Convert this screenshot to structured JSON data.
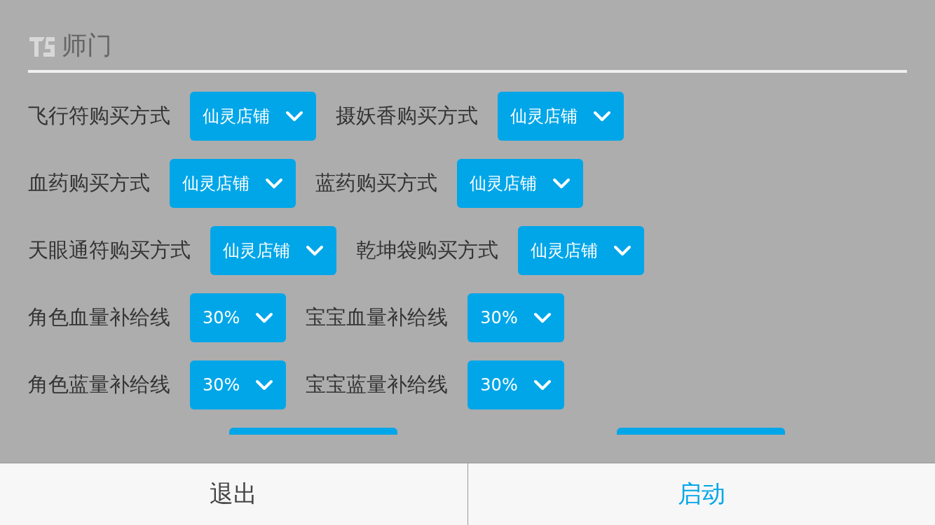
{
  "header": {
    "title": "师门"
  },
  "rows": [
    {
      "kind": "full",
      "items": [
        {
          "label": "飞行符购买方式",
          "value": "仙灵店铺"
        },
        {
          "label": "摄妖香购买方式",
          "value": "仙灵店铺"
        }
      ]
    },
    {
      "kind": "full",
      "items": [
        {
          "label": "血药购买方式",
          "value": "仙灵店铺"
        },
        {
          "label": "蓝药购买方式",
          "value": "仙灵店铺"
        }
      ]
    },
    {
      "kind": "full",
      "items": [
        {
          "label": "天眼通符购买方式",
          "value": "仙灵店铺"
        },
        {
          "label": "乾坤袋购买方式",
          "value": "仙灵店铺"
        }
      ]
    },
    {
      "kind": "full",
      "items": [
        {
          "label": "角色血量补给线",
          "value": "30%"
        },
        {
          "label": "宝宝血量补给线",
          "value": "30%"
        }
      ]
    },
    {
      "kind": "full",
      "items": [
        {
          "label": "角色蓝量补给线",
          "value": "30%"
        },
        {
          "label": "宝宝蓝量补给线",
          "value": "30%"
        }
      ]
    },
    {
      "kind": "partial",
      "items": [
        {
          "kind": "dropdown"
        },
        {
          "kind": "dropdown"
        }
      ]
    }
  ],
  "buttons": [
    {
      "label": "退出",
      "primary": false
    },
    {
      "label": "启动",
      "primary": true
    }
  ]
}
